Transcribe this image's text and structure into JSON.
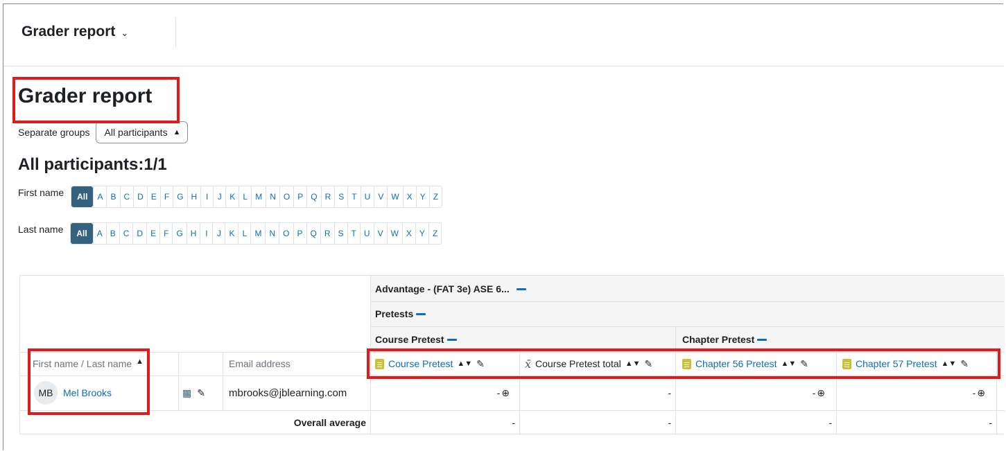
{
  "header": {
    "title": "Grader report",
    "chevron": "⌄"
  },
  "page": {
    "title": "Grader report"
  },
  "groups": {
    "label": "Separate groups",
    "selected": "All participants"
  },
  "participants": {
    "heading": "All participants:1/1"
  },
  "first_name_filter": {
    "label": "First name",
    "letters": [
      "All",
      "A",
      "B",
      "C",
      "D",
      "E",
      "F",
      "G",
      "H",
      "I",
      "J",
      "K",
      "L",
      "M",
      "N",
      "O",
      "P",
      "Q",
      "R",
      "S",
      "T",
      "U",
      "V",
      "W",
      "X",
      "Y",
      "Z"
    ]
  },
  "last_name_filter": {
    "label": "Last name",
    "letters": [
      "All",
      "A",
      "B",
      "C",
      "D",
      "E",
      "F",
      "G",
      "H",
      "I",
      "J",
      "K",
      "L",
      "M",
      "N",
      "O",
      "P",
      "Q",
      "R",
      "S",
      "T",
      "U",
      "V",
      "W",
      "X",
      "Y",
      "Z"
    ]
  },
  "table": {
    "course_category": "Advantage - (FAT 3e) ASE 6...",
    "pretests_category": "Pretests",
    "course_pretest_category": "Course Pretest",
    "chapter_pretest_category": "Chapter Pretest",
    "name_header": "First name / Last name",
    "sort_indicator": "▲",
    "email_header": "Email address",
    "items": [
      {
        "label": "Course Pretest",
        "icon": "quiz-icon"
      },
      {
        "label": "Course Pretest total",
        "icon": "mean-icon"
      },
      {
        "label": "Chapter 56 Pretest",
        "icon": "quiz-icon"
      },
      {
        "label": "Chapter 57 Pretest",
        "icon": "quiz-icon"
      }
    ],
    "student": {
      "initials": "MB",
      "name": "Mel Brooks",
      "email": "mbrooks@jblearning.com",
      "grades": [
        "-",
        "-",
        "-",
        "-"
      ]
    },
    "overall_label": "Overall average",
    "overall_values": [
      "-",
      "-",
      "-",
      "-"
    ]
  },
  "colors": {
    "accent": "#0f6cbf",
    "active_letter": "#35627e",
    "highlight": "#e01b1b"
  }
}
